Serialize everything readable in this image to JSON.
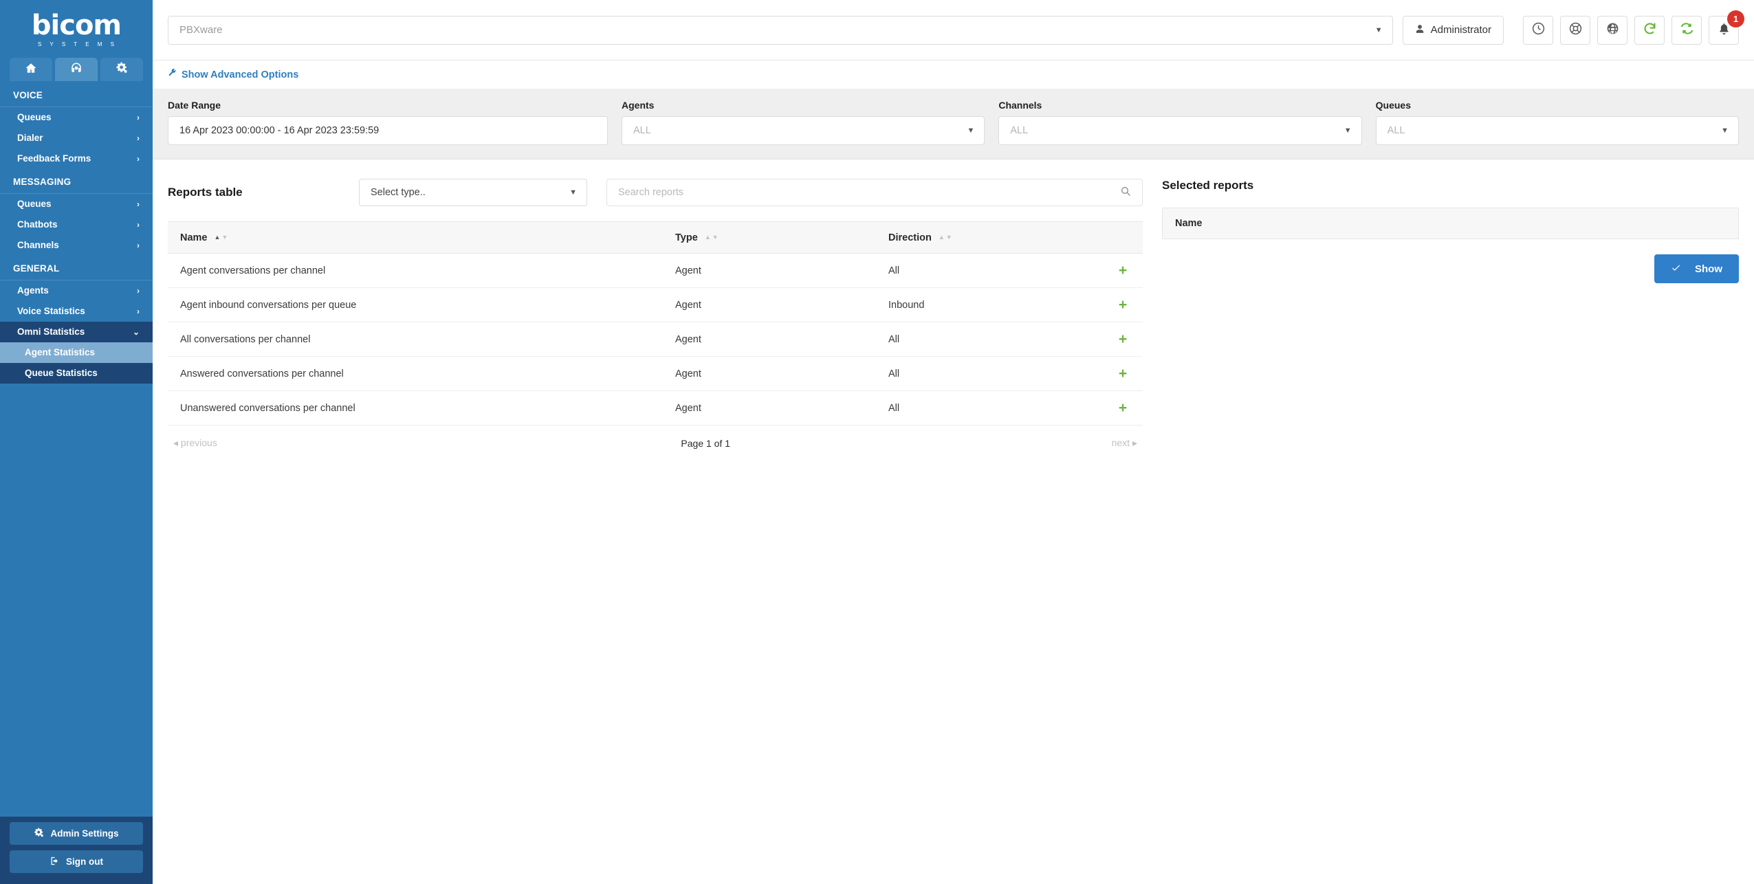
{
  "brand": {
    "name": "bicom",
    "subtitle": "S Y S T E M S"
  },
  "nav_tabs": [
    {
      "icon": "home-icon",
      "name": "home",
      "active": false
    },
    {
      "icon": "headset-icon",
      "name": "contact-center",
      "active": true
    },
    {
      "icon": "gears-icon",
      "name": "settings",
      "active": false
    }
  ],
  "sidebar": {
    "sections": [
      {
        "label": "VOICE",
        "items": [
          {
            "label": "Queues",
            "chevron": "›"
          },
          {
            "label": "Dialer",
            "chevron": "›"
          },
          {
            "label": "Feedback Forms",
            "chevron": "›"
          }
        ]
      },
      {
        "label": "MESSAGING",
        "items": [
          {
            "label": "Queues",
            "chevron": "›"
          },
          {
            "label": "Chatbots",
            "chevron": "›"
          },
          {
            "label": "Channels",
            "chevron": "›"
          }
        ]
      },
      {
        "label": "GENERAL",
        "items": [
          {
            "label": "Agents",
            "chevron": "›"
          },
          {
            "label": "Voice Statistics",
            "chevron": "›"
          },
          {
            "label": "Omni Statistics",
            "chevron": "⌄",
            "expanded": true,
            "children": [
              {
                "label": "Agent Statistics",
                "active": true
              },
              {
                "label": "Queue Statistics",
                "active": false
              }
            ]
          }
        ]
      }
    ],
    "footer": {
      "admin_settings": "Admin Settings",
      "sign_out": "Sign out"
    }
  },
  "topbar": {
    "tenant_placeholder": "PBXware",
    "admin_label": "Administrator",
    "icons": [
      {
        "name": "clock-icon"
      },
      {
        "name": "lifebuoy-icon"
      },
      {
        "name": "globe-icon"
      },
      {
        "name": "refresh-icon"
      },
      {
        "name": "sync-icon"
      },
      {
        "name": "bell-icon",
        "badge": "1"
      }
    ],
    "badge_color": "#d9342b"
  },
  "advanced": {
    "label": "Show Advanced Options",
    "icon": "wrench-icon"
  },
  "filters": [
    {
      "label": "Date Range",
      "value": "16 Apr 2023 00:00:00 - 16 Apr 2023 23:59:59",
      "placeholder": false,
      "caret": false
    },
    {
      "label": "Agents",
      "value": "ALL",
      "placeholder": true,
      "caret": true
    },
    {
      "label": "Channels",
      "value": "ALL",
      "placeholder": true,
      "caret": true
    },
    {
      "label": "Queues",
      "value": "ALL",
      "placeholder": true,
      "caret": true
    }
  ],
  "reports": {
    "title": "Reports table",
    "type_select": "Select type..",
    "search_placeholder": "Search reports",
    "columns": [
      {
        "label": "Name",
        "sort": "asc"
      },
      {
        "label": "Type",
        "sort": "none"
      },
      {
        "label": "Direction",
        "sort": "none"
      }
    ],
    "rows": [
      {
        "name": "Agent conversations per channel",
        "type": "Agent",
        "direction": "All",
        "add": "+"
      },
      {
        "name": "Agent inbound conversations per queue",
        "type": "Agent",
        "direction": "Inbound",
        "add": "+"
      },
      {
        "name": "All conversations per channel",
        "type": "Agent",
        "direction": "All",
        "add": "+"
      },
      {
        "name": "Answered conversations per channel",
        "type": "Agent",
        "direction": "All",
        "add": "+"
      },
      {
        "name": "Unanswered conversations per channel",
        "type": "Agent",
        "direction": "All",
        "add": "+"
      }
    ],
    "pager": {
      "previous": "◂ previous",
      "page_info": "Page 1 of 1",
      "next": "next ▸"
    }
  },
  "selected": {
    "title": "Selected reports",
    "column": "Name",
    "show_button": "Show",
    "show_color": "#2f7fcb"
  }
}
